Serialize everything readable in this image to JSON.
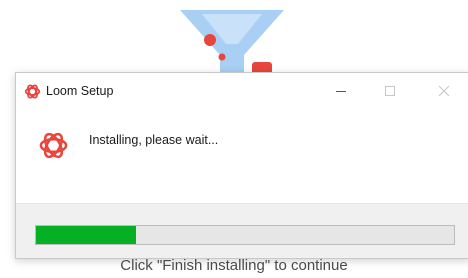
{
  "dialog": {
    "title": "Loom Setup",
    "status": "Installing, please wait...",
    "progress": 0.24
  },
  "page": {
    "continue_text": "Click \"Finish installing\" to continue"
  },
  "icons": {
    "app": "loom-logo-icon",
    "minimize": "minimize-icon",
    "maximize": "maximize-icon",
    "close": "close-icon"
  },
  "colors": {
    "progress_fill": "#06b025",
    "loom_brand": "#e8453c",
    "illustration_blue": "#9cc6f2",
    "illustration_red": "#e8453c"
  }
}
